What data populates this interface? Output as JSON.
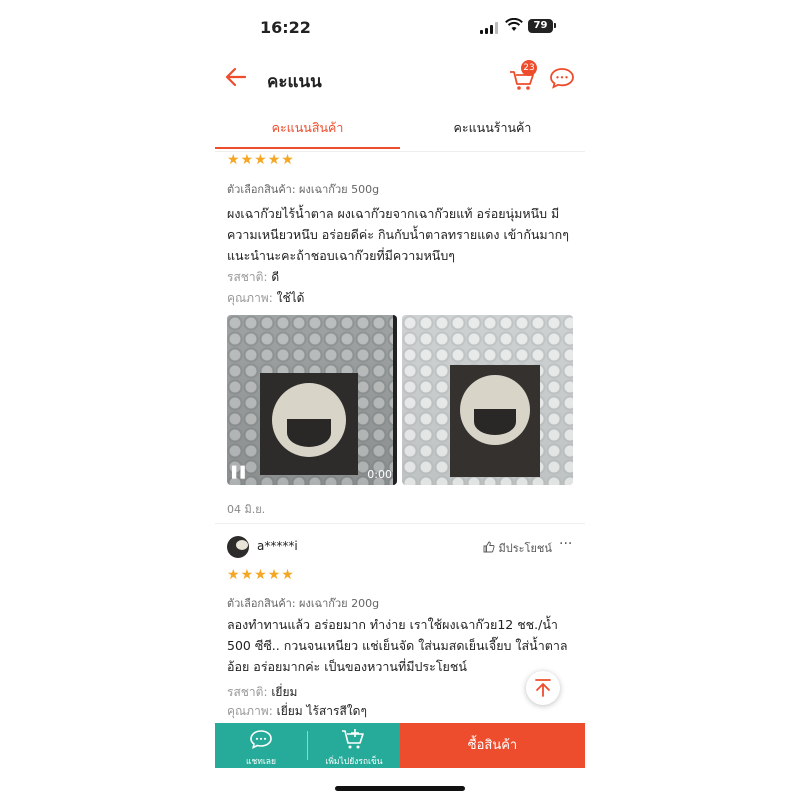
{
  "status_bar": {
    "time": "16:22",
    "battery": "79"
  },
  "header": {
    "title": "คะแนน",
    "cart_count": "23"
  },
  "tabs": [
    {
      "label": "คะแนนสินค้า",
      "active": true
    },
    {
      "label": "คะแนนร้านค้า",
      "active": false
    }
  ],
  "reviews": [
    {
      "rating": 5,
      "variant": "ตัวเลือกสินค้า: ผงเฉาก๊วย 500g",
      "text": "ผงเฉาก๊วยไร้น้ำตาล ผงเฉาก๊วยจากเฉาก๊วยแท้ อร่อยนุ่มหนึบ มีความเหนียวหนึบ อร่อยดีค่ะ กินกับน้ำตาลทรายแดง เข้ากันมากๆ แนะนำนะคะถ้าชอบเฉาก๊วยที่มีความหนึบๆ",
      "taste_label": "รสชาติ:",
      "taste_value": "ดี",
      "quality_label": "คุณภาพ:",
      "quality_value": "ใช้ได้",
      "video_duration": "0:00",
      "date": "04 มิ.ย."
    },
    {
      "username": "a*****i",
      "helpful_label": "มีประโยชน์",
      "rating": 5,
      "variant": "ตัวเลือกสินค้า: ผงเฉาก๊วย 200g",
      "text": "ลองทำทานแล้ว อร่อยมาก ทำง่าย เราใช้ผงเฉาก๊วย12 ชช./น้ำ 500 ซีซี.. กวนจนเหนียว แช่เย็นจัด ใส่นมสดเย็นเจี๊ยบ ใส่น้ำตาลอ้อย อร่อยมากค่ะ เป็นของหวานที่มีประโยชน์",
      "taste_label": "รสชาติ:",
      "taste_value": "เยี่ยม",
      "quality_label": "คุณภาพ:",
      "quality_value": "เยี่ยม ไร้สารสีใดๆ"
    }
  ],
  "bottom_bar": {
    "chat_label": "แชทเลย",
    "add_cart_label": "เพิ่มไปยังรถเข็น",
    "buy_label": "ซื้อสินค้า"
  },
  "colors": {
    "accent": "#ee4d2d",
    "teal": "#26aa99",
    "star": "#f5a623"
  },
  "icons": [
    "back-arrow-icon",
    "cart-icon",
    "chat-icon",
    "thumbs-up-icon",
    "more-icon",
    "scroll-top-icon",
    "add-cart-icon"
  ]
}
